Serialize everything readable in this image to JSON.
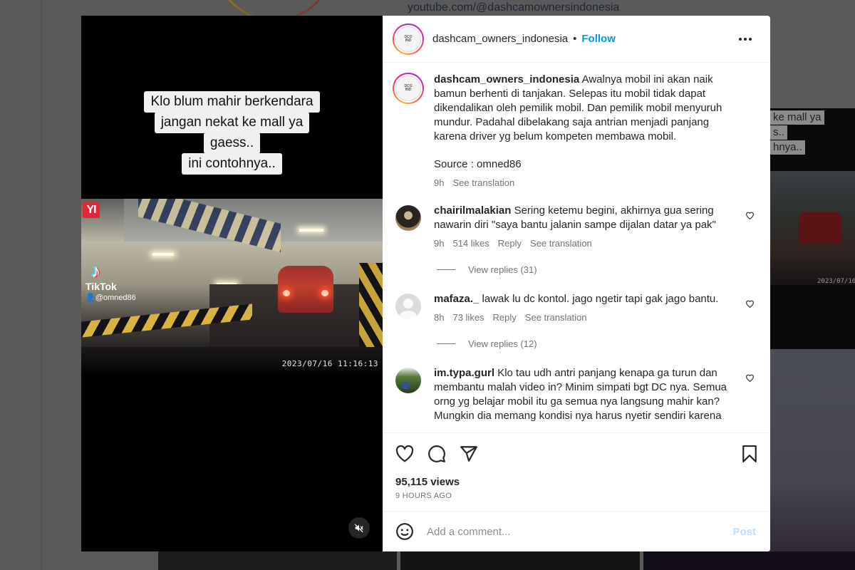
{
  "background": {
    "link_text": "youtube.com/@dashcamownersindonesia",
    "right_thumb_caption": [
      "ke mall ya",
      "s..",
      "hnya.."
    ],
    "right_thumb_timestamp": "2023/07/16"
  },
  "media": {
    "overlay_caption_lines": [
      "Klo blum mahir berkendara",
      "jangan nekat ke mall ya",
      "gaess..",
      "ini contohnya.."
    ],
    "camera_brand": "YI",
    "watermark_brand": "TikTok",
    "watermark_user": "@omned86",
    "timestamp": "2023/07/16  11:16:13",
    "muted": true
  },
  "post": {
    "header": {
      "username": "dashcam_owners_indonesia",
      "separator": "•",
      "follow_label": "Follow",
      "avatar_text": "DASHCAM OWNERS INDONESIA"
    },
    "caption": {
      "username": "dashcam_owners_indonesia",
      "text": "Awalnya mobil ini akan naik bamun berhenti di tanjakan. Selepas itu mobil tidak dapat dikendalikan oleh pemilik mobil. Dan pemilik mobil menyuruh mundur. Padahal dibelakang saja antrian menjadi panjang karena driver yg belum kompeten membawa mobil.",
      "source": "Source : omned86",
      "time": "9h",
      "see_translation": "See translation"
    },
    "comments": [
      {
        "username": "chairilmalakian",
        "text": "Sering ketemu begini, akhirnya gua sering nawarin diri \"saya bantu jalanin sampe dijalan datar ya pak\"",
        "time": "9h",
        "likes": "514 likes",
        "reply_label": "Reply",
        "see_translation": "See translation",
        "view_replies": "View replies (31)"
      },
      {
        "username": "mafaza._",
        "text": "lawak lu dc kontol. jago ngetir tapi gak jago bantu.",
        "time": "8h",
        "likes": "73 likes",
        "reply_label": "Reply",
        "see_translation": "See translation",
        "view_replies": "View replies (12)"
      },
      {
        "username": "im.typa.gurl",
        "text": "Klo tau udh antri panjang kenapa ga turun dan membantu malah video in? Minim simpati bgt DC nya. Semua orng yg belajar mobil itu ga semua nya langsung mahir kan? Mungkin dia memang kondisi nya harus nyetir sendiri karena"
      }
    ],
    "views": "95,115 views",
    "time_ago": "9 HOURS AGO",
    "add_comment_placeholder": "Add a comment...",
    "post_label": "Post"
  },
  "colors": {
    "accent": "#0095f6",
    "post_disabled": "#c0dffd",
    "overlay_bg": "#5a5a5a",
    "text_primary": "#262626",
    "text_secondary": "#737373"
  }
}
